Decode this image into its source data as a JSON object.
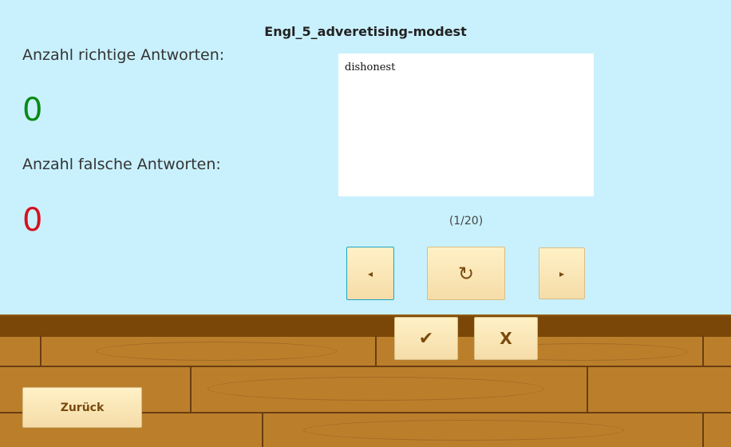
{
  "title": "Engl_5_adveretising-modest",
  "stats": {
    "correct_label": "Anzahl richtige Antworten:",
    "correct_value": "0",
    "wrong_label": "Anzahl falsche Antworten:",
    "wrong_value": "0"
  },
  "card": {
    "text": "dishonest"
  },
  "progress": "(1/20)",
  "controls": {
    "prev": "◂",
    "flip": "↻",
    "next": "▸",
    "correct": "✔",
    "wrong": "X"
  },
  "back_label": "Zurück",
  "colors": {
    "sky": "#c9f1fd",
    "correct": "#0a8a16",
    "wrong": "#d4121e",
    "button_text": "#7a4a0e"
  }
}
